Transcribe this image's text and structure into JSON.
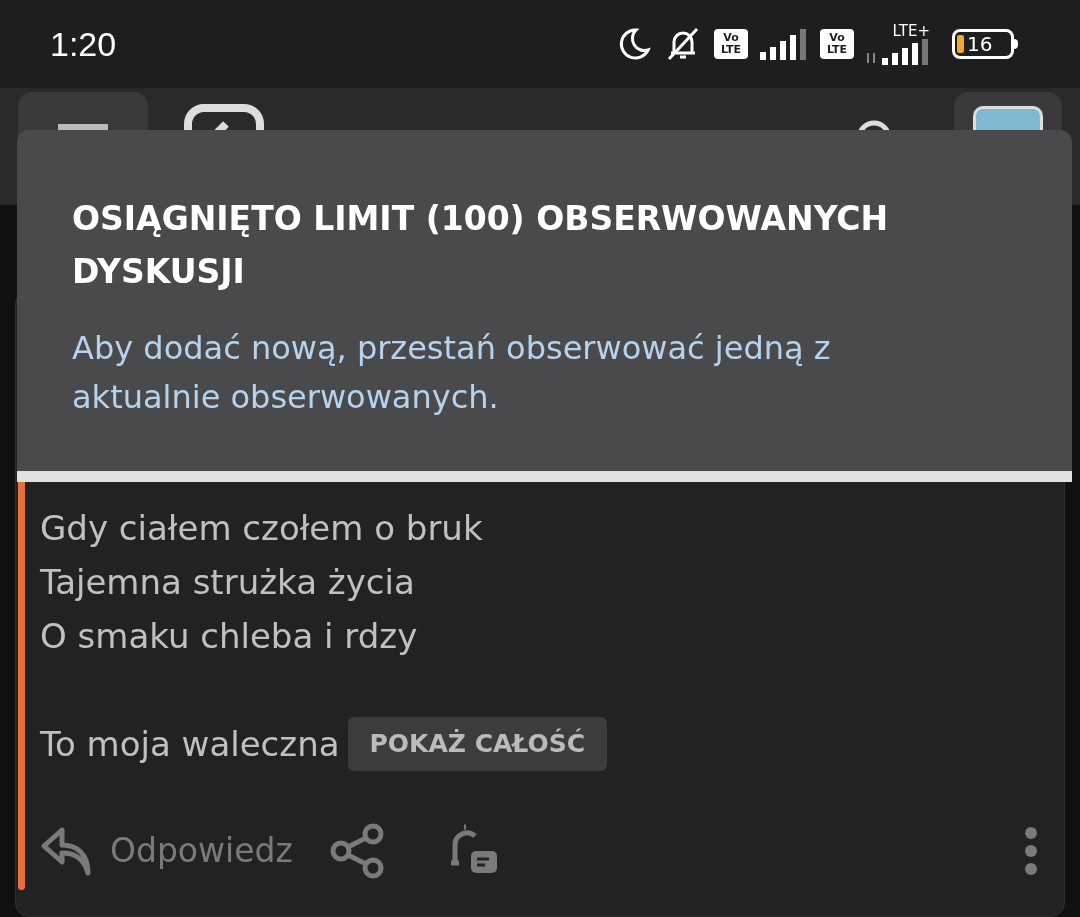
{
  "status_bar": {
    "time": "1:20",
    "volte_1": "Vo LTE",
    "volte_2": "Vo LTE",
    "network": "LTE+",
    "battery": "16"
  },
  "toast": {
    "title": "OSIĄGNIĘTO LIMIT (100) OBSERWOWANYCH DYSKUSJI",
    "message": "Aby dodać nową, przestań obserwować jedną z aktualnie obserwowanych."
  },
  "post": {
    "stanzas": [
      [
        "Gdy ciałem czołem o bruk",
        "Tajemna strużka życia",
        "O smaku chleba i rdzy"
      ],
      [
        "To moja waleczna"
      ]
    ],
    "show_more": "POKAŻ CAŁOŚĆ",
    "reply": "Odpowiedz"
  }
}
